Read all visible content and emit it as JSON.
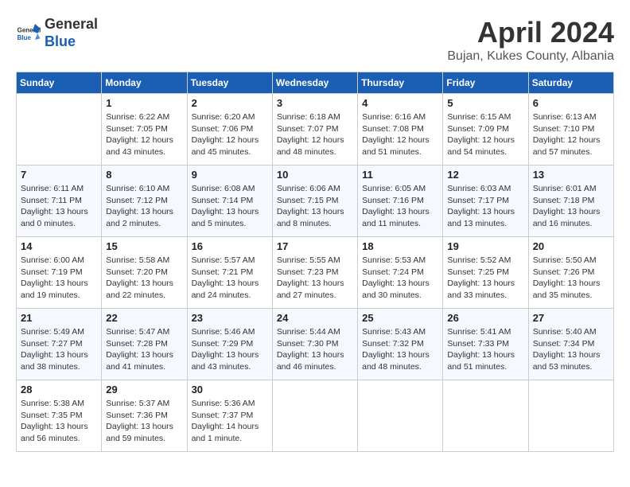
{
  "header": {
    "logo_line1": "General",
    "logo_line2": "Blue",
    "title": "April 2024",
    "location": "Bujan, Kukes County, Albania"
  },
  "days_of_week": [
    "Sunday",
    "Monday",
    "Tuesday",
    "Wednesday",
    "Thursday",
    "Friday",
    "Saturday"
  ],
  "weeks": [
    [
      {
        "day": "",
        "info": ""
      },
      {
        "day": "1",
        "info": "Sunrise: 6:22 AM\nSunset: 7:05 PM\nDaylight: 12 hours\nand 43 minutes."
      },
      {
        "day": "2",
        "info": "Sunrise: 6:20 AM\nSunset: 7:06 PM\nDaylight: 12 hours\nand 45 minutes."
      },
      {
        "day": "3",
        "info": "Sunrise: 6:18 AM\nSunset: 7:07 PM\nDaylight: 12 hours\nand 48 minutes."
      },
      {
        "day": "4",
        "info": "Sunrise: 6:16 AM\nSunset: 7:08 PM\nDaylight: 12 hours\nand 51 minutes."
      },
      {
        "day": "5",
        "info": "Sunrise: 6:15 AM\nSunset: 7:09 PM\nDaylight: 12 hours\nand 54 minutes."
      },
      {
        "day": "6",
        "info": "Sunrise: 6:13 AM\nSunset: 7:10 PM\nDaylight: 12 hours\nand 57 minutes."
      }
    ],
    [
      {
        "day": "7",
        "info": "Sunrise: 6:11 AM\nSunset: 7:11 PM\nDaylight: 13 hours\nand 0 minutes."
      },
      {
        "day": "8",
        "info": "Sunrise: 6:10 AM\nSunset: 7:12 PM\nDaylight: 13 hours\nand 2 minutes."
      },
      {
        "day": "9",
        "info": "Sunrise: 6:08 AM\nSunset: 7:14 PM\nDaylight: 13 hours\nand 5 minutes."
      },
      {
        "day": "10",
        "info": "Sunrise: 6:06 AM\nSunset: 7:15 PM\nDaylight: 13 hours\nand 8 minutes."
      },
      {
        "day": "11",
        "info": "Sunrise: 6:05 AM\nSunset: 7:16 PM\nDaylight: 13 hours\nand 11 minutes."
      },
      {
        "day": "12",
        "info": "Sunrise: 6:03 AM\nSunset: 7:17 PM\nDaylight: 13 hours\nand 13 minutes."
      },
      {
        "day": "13",
        "info": "Sunrise: 6:01 AM\nSunset: 7:18 PM\nDaylight: 13 hours\nand 16 minutes."
      }
    ],
    [
      {
        "day": "14",
        "info": "Sunrise: 6:00 AM\nSunset: 7:19 PM\nDaylight: 13 hours\nand 19 minutes."
      },
      {
        "day": "15",
        "info": "Sunrise: 5:58 AM\nSunset: 7:20 PM\nDaylight: 13 hours\nand 22 minutes."
      },
      {
        "day": "16",
        "info": "Sunrise: 5:57 AM\nSunset: 7:21 PM\nDaylight: 13 hours\nand 24 minutes."
      },
      {
        "day": "17",
        "info": "Sunrise: 5:55 AM\nSunset: 7:23 PM\nDaylight: 13 hours\nand 27 minutes."
      },
      {
        "day": "18",
        "info": "Sunrise: 5:53 AM\nSunset: 7:24 PM\nDaylight: 13 hours\nand 30 minutes."
      },
      {
        "day": "19",
        "info": "Sunrise: 5:52 AM\nSunset: 7:25 PM\nDaylight: 13 hours\nand 33 minutes."
      },
      {
        "day": "20",
        "info": "Sunrise: 5:50 AM\nSunset: 7:26 PM\nDaylight: 13 hours\nand 35 minutes."
      }
    ],
    [
      {
        "day": "21",
        "info": "Sunrise: 5:49 AM\nSunset: 7:27 PM\nDaylight: 13 hours\nand 38 minutes."
      },
      {
        "day": "22",
        "info": "Sunrise: 5:47 AM\nSunset: 7:28 PM\nDaylight: 13 hours\nand 41 minutes."
      },
      {
        "day": "23",
        "info": "Sunrise: 5:46 AM\nSunset: 7:29 PM\nDaylight: 13 hours\nand 43 minutes."
      },
      {
        "day": "24",
        "info": "Sunrise: 5:44 AM\nSunset: 7:30 PM\nDaylight: 13 hours\nand 46 minutes."
      },
      {
        "day": "25",
        "info": "Sunrise: 5:43 AM\nSunset: 7:32 PM\nDaylight: 13 hours\nand 48 minutes."
      },
      {
        "day": "26",
        "info": "Sunrise: 5:41 AM\nSunset: 7:33 PM\nDaylight: 13 hours\nand 51 minutes."
      },
      {
        "day": "27",
        "info": "Sunrise: 5:40 AM\nSunset: 7:34 PM\nDaylight: 13 hours\nand 53 minutes."
      }
    ],
    [
      {
        "day": "28",
        "info": "Sunrise: 5:38 AM\nSunset: 7:35 PM\nDaylight: 13 hours\nand 56 minutes."
      },
      {
        "day": "29",
        "info": "Sunrise: 5:37 AM\nSunset: 7:36 PM\nDaylight: 13 hours\nand 59 minutes."
      },
      {
        "day": "30",
        "info": "Sunrise: 5:36 AM\nSunset: 7:37 PM\nDaylight: 14 hours\nand 1 minute."
      },
      {
        "day": "",
        "info": ""
      },
      {
        "day": "",
        "info": ""
      },
      {
        "day": "",
        "info": ""
      },
      {
        "day": "",
        "info": ""
      }
    ]
  ]
}
